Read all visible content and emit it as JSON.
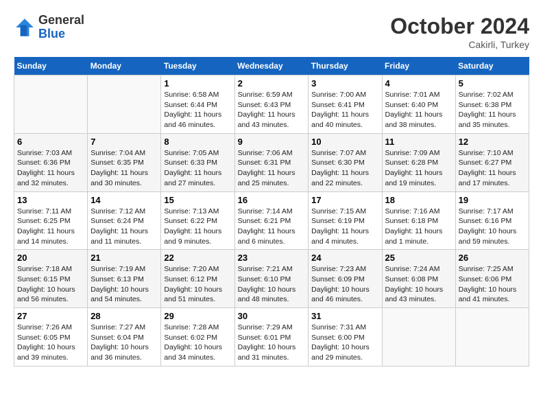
{
  "header": {
    "logo_general": "General",
    "logo_blue": "Blue",
    "month_title": "October 2024",
    "location": "Cakirli, Turkey"
  },
  "days_of_week": [
    "Sunday",
    "Monday",
    "Tuesday",
    "Wednesday",
    "Thursday",
    "Friday",
    "Saturday"
  ],
  "weeks": [
    [
      {
        "num": "",
        "info": ""
      },
      {
        "num": "",
        "info": ""
      },
      {
        "num": "1",
        "info": "Sunrise: 6:58 AM\nSunset: 6:44 PM\nDaylight: 11 hours and 46 minutes."
      },
      {
        "num": "2",
        "info": "Sunrise: 6:59 AM\nSunset: 6:43 PM\nDaylight: 11 hours and 43 minutes."
      },
      {
        "num": "3",
        "info": "Sunrise: 7:00 AM\nSunset: 6:41 PM\nDaylight: 11 hours and 40 minutes."
      },
      {
        "num": "4",
        "info": "Sunrise: 7:01 AM\nSunset: 6:40 PM\nDaylight: 11 hours and 38 minutes."
      },
      {
        "num": "5",
        "info": "Sunrise: 7:02 AM\nSunset: 6:38 PM\nDaylight: 11 hours and 35 minutes."
      }
    ],
    [
      {
        "num": "6",
        "info": "Sunrise: 7:03 AM\nSunset: 6:36 PM\nDaylight: 11 hours and 32 minutes."
      },
      {
        "num": "7",
        "info": "Sunrise: 7:04 AM\nSunset: 6:35 PM\nDaylight: 11 hours and 30 minutes."
      },
      {
        "num": "8",
        "info": "Sunrise: 7:05 AM\nSunset: 6:33 PM\nDaylight: 11 hours and 27 minutes."
      },
      {
        "num": "9",
        "info": "Sunrise: 7:06 AM\nSunset: 6:31 PM\nDaylight: 11 hours and 25 minutes."
      },
      {
        "num": "10",
        "info": "Sunrise: 7:07 AM\nSunset: 6:30 PM\nDaylight: 11 hours and 22 minutes."
      },
      {
        "num": "11",
        "info": "Sunrise: 7:09 AM\nSunset: 6:28 PM\nDaylight: 11 hours and 19 minutes."
      },
      {
        "num": "12",
        "info": "Sunrise: 7:10 AM\nSunset: 6:27 PM\nDaylight: 11 hours and 17 minutes."
      }
    ],
    [
      {
        "num": "13",
        "info": "Sunrise: 7:11 AM\nSunset: 6:25 PM\nDaylight: 11 hours and 14 minutes."
      },
      {
        "num": "14",
        "info": "Sunrise: 7:12 AM\nSunset: 6:24 PM\nDaylight: 11 hours and 11 minutes."
      },
      {
        "num": "15",
        "info": "Sunrise: 7:13 AM\nSunset: 6:22 PM\nDaylight: 11 hours and 9 minutes."
      },
      {
        "num": "16",
        "info": "Sunrise: 7:14 AM\nSunset: 6:21 PM\nDaylight: 11 hours and 6 minutes."
      },
      {
        "num": "17",
        "info": "Sunrise: 7:15 AM\nSunset: 6:19 PM\nDaylight: 11 hours and 4 minutes."
      },
      {
        "num": "18",
        "info": "Sunrise: 7:16 AM\nSunset: 6:18 PM\nDaylight: 11 hours and 1 minute."
      },
      {
        "num": "19",
        "info": "Sunrise: 7:17 AM\nSunset: 6:16 PM\nDaylight: 10 hours and 59 minutes."
      }
    ],
    [
      {
        "num": "20",
        "info": "Sunrise: 7:18 AM\nSunset: 6:15 PM\nDaylight: 10 hours and 56 minutes."
      },
      {
        "num": "21",
        "info": "Sunrise: 7:19 AM\nSunset: 6:13 PM\nDaylight: 10 hours and 54 minutes."
      },
      {
        "num": "22",
        "info": "Sunrise: 7:20 AM\nSunset: 6:12 PM\nDaylight: 10 hours and 51 minutes."
      },
      {
        "num": "23",
        "info": "Sunrise: 7:21 AM\nSunset: 6:10 PM\nDaylight: 10 hours and 48 minutes."
      },
      {
        "num": "24",
        "info": "Sunrise: 7:23 AM\nSunset: 6:09 PM\nDaylight: 10 hours and 46 minutes."
      },
      {
        "num": "25",
        "info": "Sunrise: 7:24 AM\nSunset: 6:08 PM\nDaylight: 10 hours and 43 minutes."
      },
      {
        "num": "26",
        "info": "Sunrise: 7:25 AM\nSunset: 6:06 PM\nDaylight: 10 hours and 41 minutes."
      }
    ],
    [
      {
        "num": "27",
        "info": "Sunrise: 7:26 AM\nSunset: 6:05 PM\nDaylight: 10 hours and 39 minutes."
      },
      {
        "num": "28",
        "info": "Sunrise: 7:27 AM\nSunset: 6:04 PM\nDaylight: 10 hours and 36 minutes."
      },
      {
        "num": "29",
        "info": "Sunrise: 7:28 AM\nSunset: 6:02 PM\nDaylight: 10 hours and 34 minutes."
      },
      {
        "num": "30",
        "info": "Sunrise: 7:29 AM\nSunset: 6:01 PM\nDaylight: 10 hours and 31 minutes."
      },
      {
        "num": "31",
        "info": "Sunrise: 7:31 AM\nSunset: 6:00 PM\nDaylight: 10 hours and 29 minutes."
      },
      {
        "num": "",
        "info": ""
      },
      {
        "num": "",
        "info": ""
      }
    ]
  ]
}
